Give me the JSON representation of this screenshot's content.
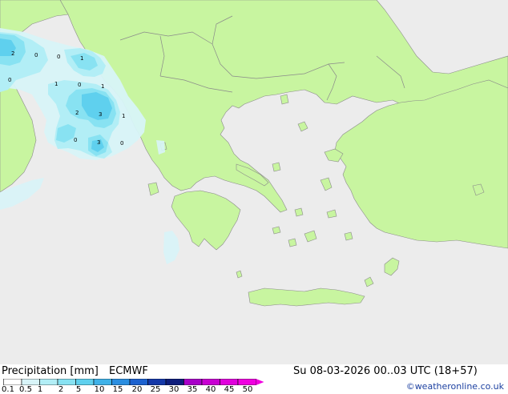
{
  "footer": {
    "title": "Precipitation [mm]",
    "model": "ECMWF",
    "datetime": "Su 08-03-2026 00..03 UTC (18+57)",
    "credit": "©weatheronline.co.uk"
  },
  "legend": {
    "ticks": [
      "0.1",
      "0.5",
      "1",
      "2",
      "5",
      "10",
      "15",
      "20",
      "25",
      "30",
      "35",
      "40",
      "45",
      "50"
    ],
    "colors": [
      "#ffffff",
      "#d8f4f8",
      "#b2eef6",
      "#88e2f2",
      "#5fd0ee",
      "#3fb2e8",
      "#2a8ee0",
      "#1d62cf",
      "#1538a8",
      "#0e1d7c",
      "#a800c8",
      "#c800d2",
      "#e000dc",
      "#f000e0"
    ]
  },
  "map": {
    "land_color": "#c8f5a0",
    "sea_color": "#ececec",
    "border_color": "#a0a0a0",
    "labels": [
      "2",
      "0",
      "0",
      "1",
      "0",
      "1",
      "0",
      "1",
      "2",
      "3",
      "1",
      "0",
      "3",
      "0"
    ]
  }
}
